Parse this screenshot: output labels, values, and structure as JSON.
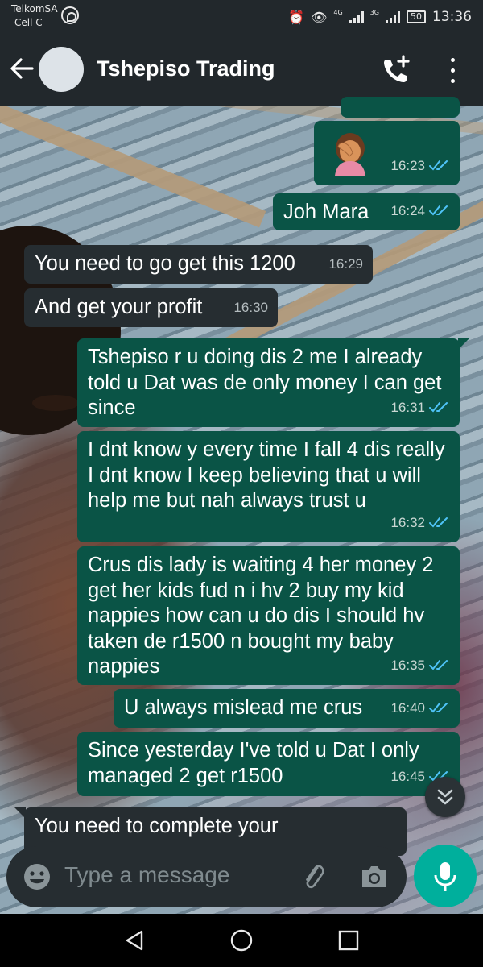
{
  "status_bar": {
    "carrier1": "TelkomSA",
    "carrier2": "Cell C",
    "net1": "4G",
    "net2": "3G",
    "battery": "50",
    "time": "13:36"
  },
  "header": {
    "title": "Tshepiso Trading"
  },
  "messages": [
    {
      "dir": "out",
      "kind": "emoji",
      "emoji": "woman-facepalming",
      "time": "16:23",
      "ticks": "read"
    },
    {
      "dir": "out",
      "text": "Joh Mara",
      "time": "16:24",
      "ticks": "read"
    },
    {
      "dir": "in",
      "text": "You need to go get this 1200",
      "time": "16:29"
    },
    {
      "dir": "in",
      "text": "And get your profit",
      "time": "16:30"
    },
    {
      "dir": "out",
      "text": "Tshepiso r u doing dis 2 me I already told u Dat was de only money I can get since",
      "time": "16:31",
      "ticks": "read"
    },
    {
      "dir": "out",
      "text": "I dnt know y every time I fall 4 dis really I dnt know I keep believing that u will help me but nah always trust u",
      "time": "16:32",
      "ticks": "read"
    },
    {
      "dir": "out",
      "text": "Crus dis lady is waiting 4 her money 2 get her kids fud n i hv 2 buy my kid nappies how can u do dis I should hv taken de r1500 n bought my baby nappies",
      "time": "16:35",
      "ticks": "read"
    },
    {
      "dir": "out",
      "text": "U always mislead me crus",
      "time": "16:40",
      "ticks": "read"
    },
    {
      "dir": "out",
      "text": "Since yesterday I've told u Dat I only managed 2 get r1500",
      "time": "16:45",
      "ticks": "read"
    },
    {
      "dir": "in",
      "text": "You need to complete your",
      "time": ""
    }
  ],
  "input": {
    "placeholder": "Type a message"
  },
  "colors": {
    "outgoing_bubble": "#0a5446",
    "incoming_bubble": "#262d31",
    "header_bg": "#22282c",
    "read_ticks": "#4fc3f7",
    "mic_button": "#00af9c"
  }
}
